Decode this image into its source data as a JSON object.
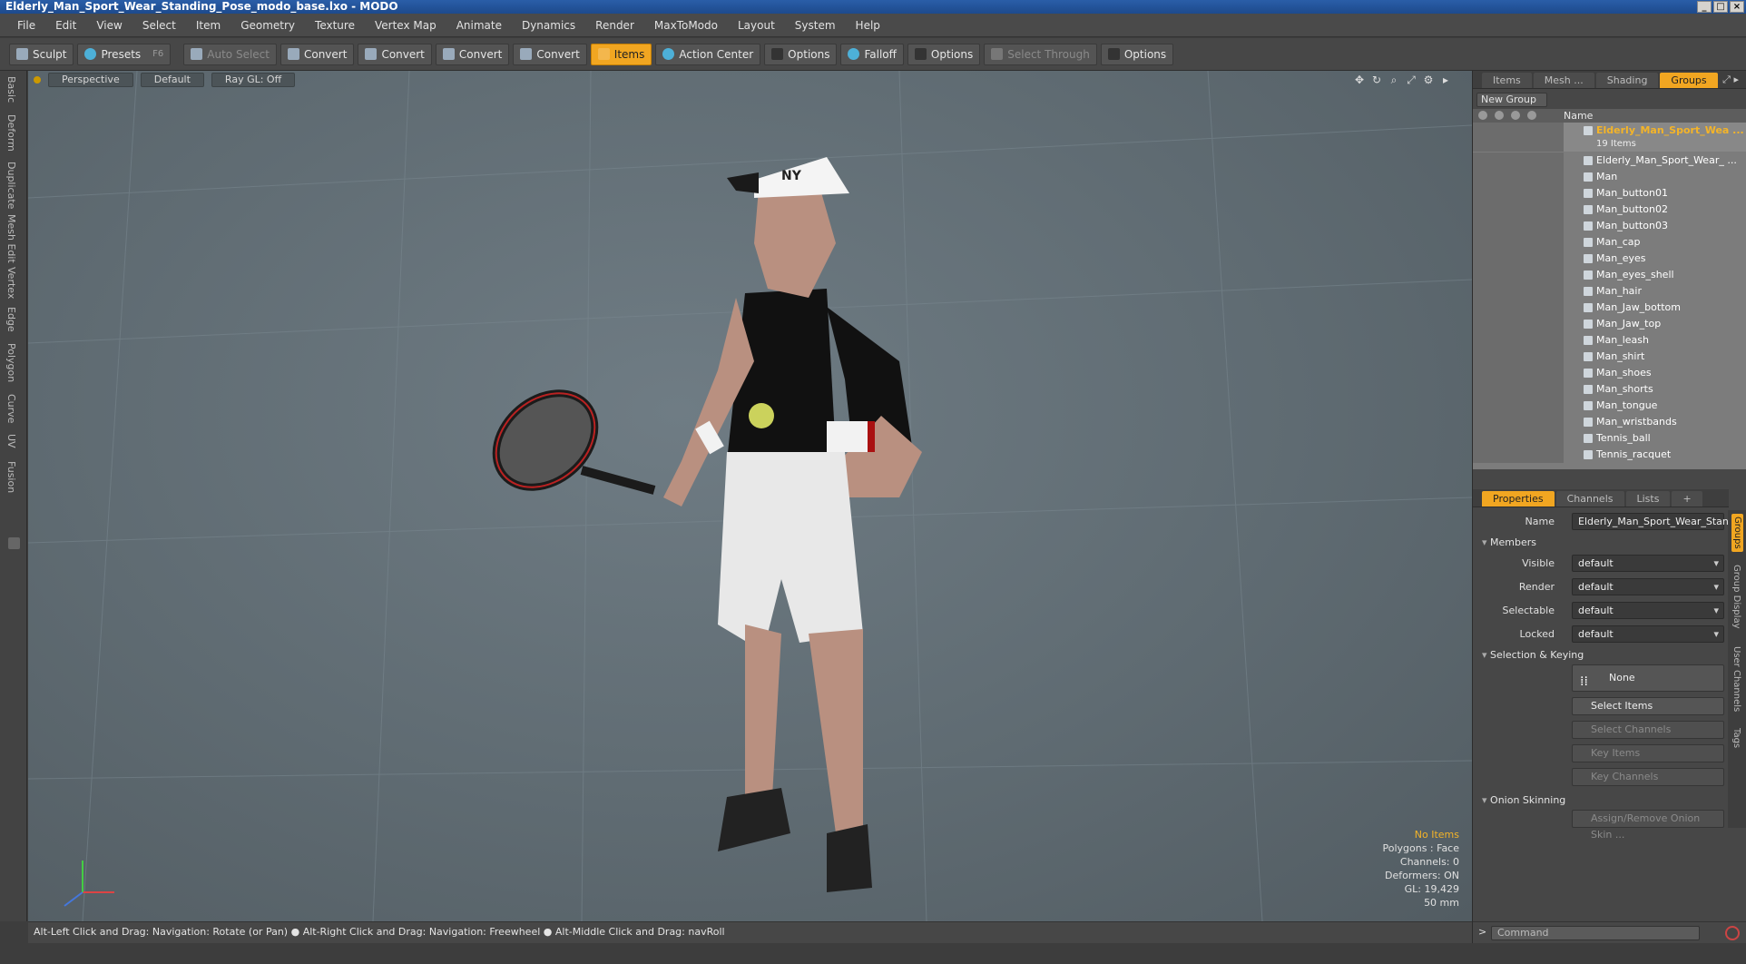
{
  "window": {
    "title": "Elderly_Man_Sport_Wear_Standing_Pose_modo_base.lxo - MODO",
    "controls": [
      "_",
      "□",
      "×"
    ]
  },
  "menu": [
    "File",
    "Edit",
    "View",
    "Select",
    "Item",
    "Geometry",
    "Texture",
    "Vertex Map",
    "Animate",
    "Dynamics",
    "Render",
    "MaxToModo",
    "Layout",
    "System",
    "Help"
  ],
  "toolbar": {
    "sculpt": "Sculpt",
    "presets": "Presets",
    "presets_shortcut": "F6",
    "auto_select": "Auto Select",
    "convert1": "Convert",
    "convert2": "Convert",
    "convert3": "Convert",
    "convert4": "Convert",
    "items": "Items",
    "action_center": "Action Center",
    "options1": "Options",
    "falloff": "Falloff",
    "options2": "Options",
    "select_through": "Select Through",
    "options3": "Options"
  },
  "left_tabs": [
    "Basic",
    "Deform",
    "Duplicate",
    "Mesh Edit",
    "Vertex",
    "Edge",
    "Polygon",
    "Curve",
    "UV",
    "Fusion"
  ],
  "viewport": {
    "view": "Perspective",
    "shading": "Default",
    "raygl": "Ray GL: Off",
    "info": {
      "items": "No Items",
      "polygons": "Polygons : Face",
      "channels": "Channels: 0",
      "deformers": "Deformers: ON",
      "gl": "GL: 19,429",
      "focal": "50 mm"
    },
    "cap_logo": "NY"
  },
  "status": "Alt-Left Click and Drag: Navigation: Rotate (or Pan) ● Alt-Right Click and Drag: Navigation: Freewheel ● Alt-Middle Click and Drag: navRoll",
  "panel_top": {
    "tabs": [
      "Items",
      "Mesh ...",
      "Shading",
      "Groups"
    ],
    "active_tab": "Groups",
    "new_group": "New Group",
    "col_name": "Name",
    "group_name": "Elderly_Man_Sport_Wea ...",
    "group_count": "19 Items",
    "items": [
      "Elderly_Man_Sport_Wear_ ...",
      "Man",
      "Man_button01",
      "Man_button02",
      "Man_button03",
      "Man_cap",
      "Man_eyes",
      "Man_eyes_shell",
      "Man_hair",
      "Man_Jaw_bottom",
      "Man_Jaw_top",
      "Man_leash",
      "Man_shirt",
      "Man_shoes",
      "Man_shorts",
      "Man_tongue",
      "Man_wristbands",
      "Tennis_ball",
      "Tennis_racquet"
    ]
  },
  "panel_props": {
    "tabs": [
      "Properties",
      "Channels",
      "Lists",
      "+"
    ],
    "name_label": "Name",
    "name_value": "Elderly_Man_Sport_Wear_Stand",
    "members": "Members",
    "visible_label": "Visible",
    "visible_value": "default",
    "render_label": "Render",
    "render_value": "default",
    "selectable_label": "Selectable",
    "selectable_value": "default",
    "locked_label": "Locked",
    "locked_value": "default",
    "selkey": "Selection & Keying",
    "none": "None",
    "select_items": "Select Items",
    "select_channels": "Select Channels",
    "key_items": "Key Items",
    "key_channels": "Key Channels",
    "onion": "Onion Skinning",
    "assign_onion": "Assign/Remove Onion Skin ...",
    "side_tabs": [
      "Groups",
      "Group Display",
      "User Channels",
      "Tags"
    ]
  },
  "command": {
    "prompt": ">",
    "placeholder": "Command"
  }
}
